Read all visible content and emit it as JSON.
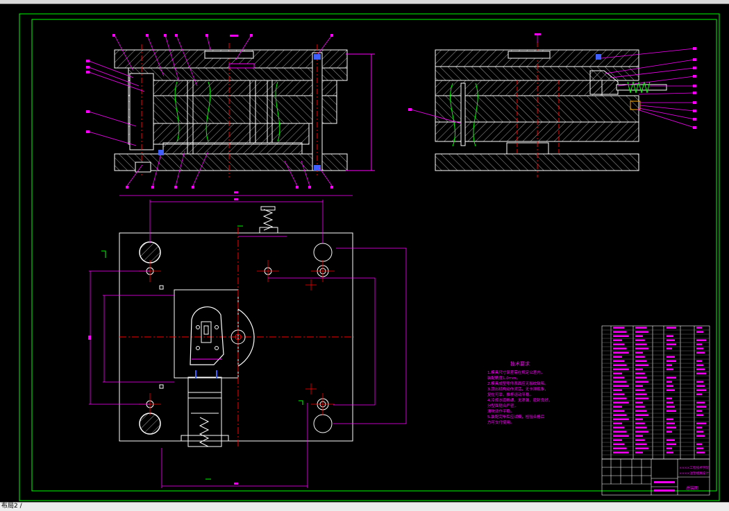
{
  "window": {
    "layout_tab": "布局2 /"
  },
  "title_block": {
    "line1": "××××工程技术学院",
    "line2": "××××注塑模具设计",
    "drawing_name": "总装图"
  },
  "technical_requirements": {
    "heading": "技术要求",
    "items": [
      "1.模具尺寸误差需在规定公差内，",
      "  装配精度1.0mm。",
      "2.模具成型零件表面应无裂纹缺陷。",
      "3.顶出机构动作灵活，无卡滞现象，",
      "  复位可靠，推杆运动平稳。",
      "4.冷却水道畅通，无渗漏，密封良好，",
      "  分型面贴合严密，",
      "  滑块动作平稳。",
      "5.装配完毕后应试模，检验合格后",
      "  方可交付使用。"
    ]
  },
  "colors": {
    "background": "#000000",
    "frame": "#00ff00",
    "geometry": "#ffffff",
    "hatch": "#ffffff",
    "centerline": "#ff0000",
    "dimension": "#ff00ff",
    "spring": "#00ff00",
    "bolt": "#4060ff"
  }
}
